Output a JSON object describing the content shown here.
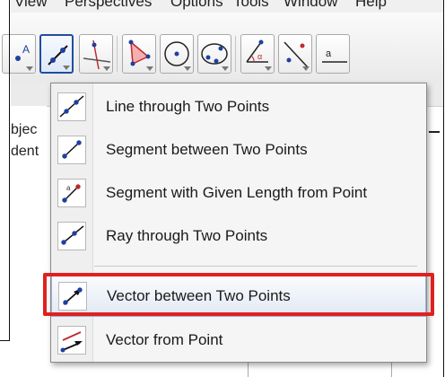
{
  "menubar": {
    "items": [
      "View",
      "Perspectives",
      "Options",
      "Tools",
      "Window",
      "Help"
    ]
  },
  "toolbar": {
    "tools": [
      {
        "icon": "move-text-tool-icon"
      },
      {
        "icon": "line-tool-icon",
        "selected": true
      },
      {
        "icon": "perpendicular-line-tool-icon"
      },
      {
        "icon": "polygon-tool-icon"
      },
      {
        "icon": "circle-tool-icon"
      },
      {
        "icon": "conic-tool-icon"
      },
      {
        "icon": "angle-tool-icon"
      },
      {
        "icon": "reflect-tool-icon"
      },
      {
        "icon": "slider-tool-icon"
      }
    ],
    "tool0_text": "A",
    "tool6_text": "α",
    "tool8_text": "a"
  },
  "side_panel": {
    "line1": "bjec",
    "line2": "dent"
  },
  "dropdown": {
    "items": [
      {
        "label": "Line through Two Points",
        "icon": "line-through-two-points-icon"
      },
      {
        "label": "Segment between Two Points",
        "icon": "segment-between-two-points-icon"
      },
      {
        "label": "Segment with Given Length from Point",
        "icon": "segment-given-length-icon",
        "icon_text": "a"
      },
      {
        "label": "Ray through Two Points",
        "icon": "ray-through-two-points-icon"
      },
      {
        "label": "Vector between Two Points",
        "icon": "vector-between-two-points-icon",
        "highlighted": true
      },
      {
        "label": "Vector from Point",
        "icon": "vector-from-point-icon"
      }
    ]
  },
  "colors": {
    "highlight_box": "#e02020",
    "point_blue": "#1f3fa0",
    "point_red": "#c0282d",
    "selected_border": "#1f4f9c"
  }
}
